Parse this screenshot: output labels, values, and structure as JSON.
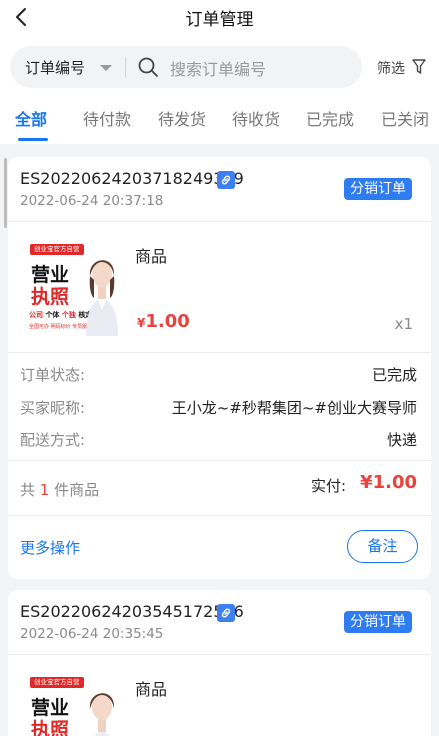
{
  "header": {
    "title": "订单管理"
  },
  "search": {
    "field_select": "订单编号",
    "placeholder": "搜索订单编号",
    "filter_label": "筛选"
  },
  "tabs": [
    {
      "label": "全部",
      "active": true
    },
    {
      "label": "待付款",
      "active": false
    },
    {
      "label": "待发货",
      "active": false
    },
    {
      "label": "待收货",
      "active": false
    },
    {
      "label": "已完成",
      "active": false
    },
    {
      "label": "已关闭",
      "active": false
    }
  ],
  "thumb": {
    "ribbon": "创业宝官方自营",
    "big1": "营业",
    "big2": "执照",
    "line": "公司 个体 个独 核定",
    "line_parts": [
      "公司",
      "个体",
      "个独",
      "核定"
    ],
    "foot": "全国可办  明码标价  专员服务"
  },
  "orders": [
    {
      "order_no": "ES20220624203718249319",
      "date": "2022-06-24 20:37:18",
      "badge": "分销订单",
      "product_name": "商品",
      "currency": "¥",
      "price": "1.00",
      "qty": "x1",
      "status_label": "订单状态:",
      "status_value": "已完成",
      "buyer_label": "买家昵称:",
      "buyer_value": "王小龙~#秒帮集团~#创业大赛导师",
      "delivery_label": "配送方式:",
      "delivery_value": "快递",
      "count_prefix": "共",
      "count": "1",
      "count_suffix": "件商品",
      "paid_label": "实付:",
      "paid_value": "¥1.00",
      "more_label": "更多操作",
      "note_label": "备注"
    },
    {
      "order_no": "ES20220624203545172576",
      "date": "2022-06-24 20:35:45",
      "badge": "分销订单",
      "product_name": "商品"
    }
  ],
  "colors": {
    "accent": "#1976f0",
    "price": "#e8433c",
    "badge": "#2f7cf2"
  },
  "icons": [
    "back-arrow-icon",
    "caret-down-icon",
    "search-icon",
    "filter-icon",
    "link-icon"
  ]
}
